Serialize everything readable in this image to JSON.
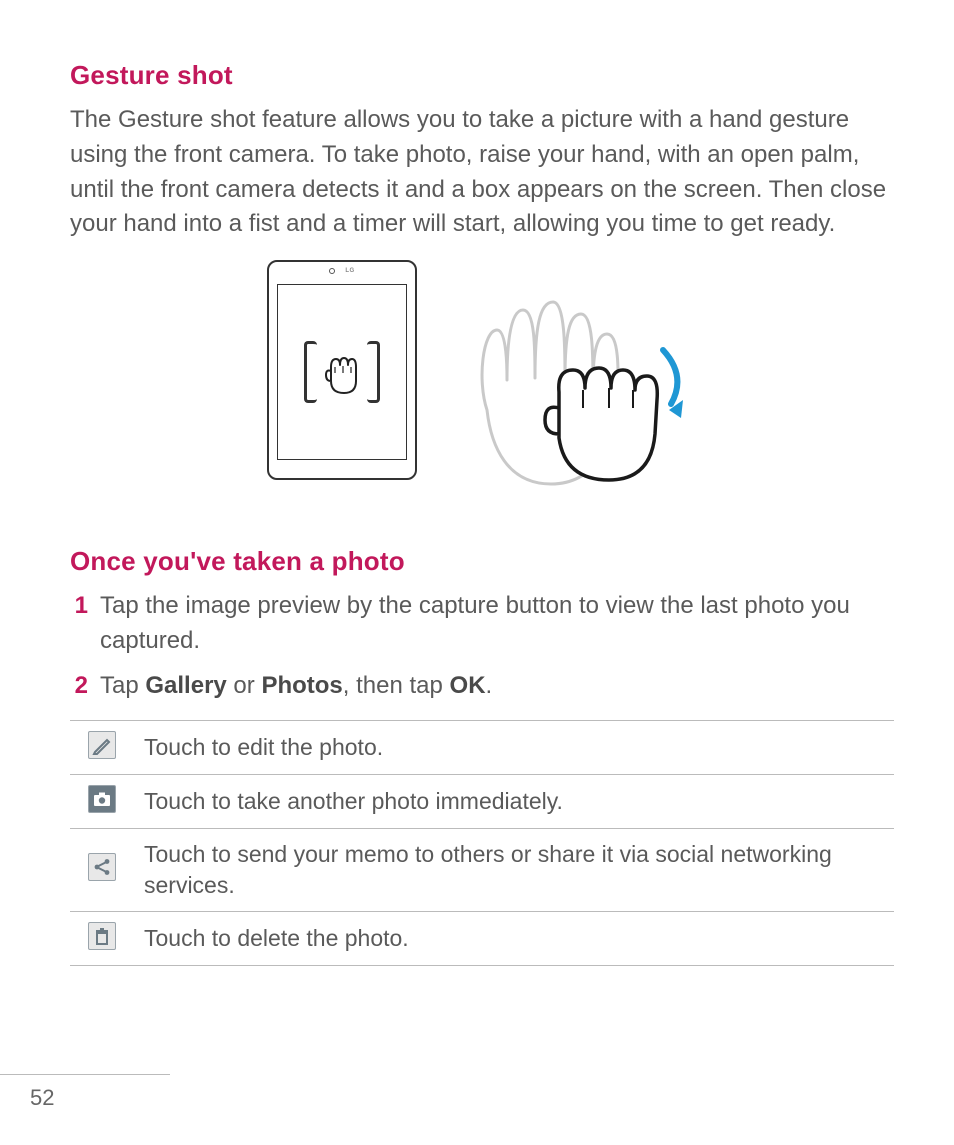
{
  "section1": {
    "title": "Gesture shot",
    "body": "The Gesture shot feature allows you to take a picture with a hand gesture using the front camera. To take photo, raise your hand, with an open palm, until the front camera detects it and a box appears on the screen. Then close your hand into a fist and a timer will start, allowing you time to get ready."
  },
  "tablet_logo": "LG",
  "section2": {
    "title": "Once you've taken a photo",
    "steps": [
      {
        "n": "1",
        "text": "Tap the image preview by the capture button to view the last photo you captured."
      },
      {
        "n": "2",
        "prefix": "Tap ",
        "b1": "Gallery",
        "mid1": " or ",
        "b2": "Photos",
        "mid2": ", then tap ",
        "b3": "OK",
        "suffix": "."
      }
    ]
  },
  "icon_rows": [
    {
      "icon": "edit",
      "text": "Touch to edit the photo."
    },
    {
      "icon": "camera",
      "text": "Touch to take another photo immediately."
    },
    {
      "icon": "share",
      "text": "Touch to send your memo to others or share it via social networking services."
    },
    {
      "icon": "trash",
      "text": "Touch to delete the photo."
    }
  ],
  "page_number": "52"
}
